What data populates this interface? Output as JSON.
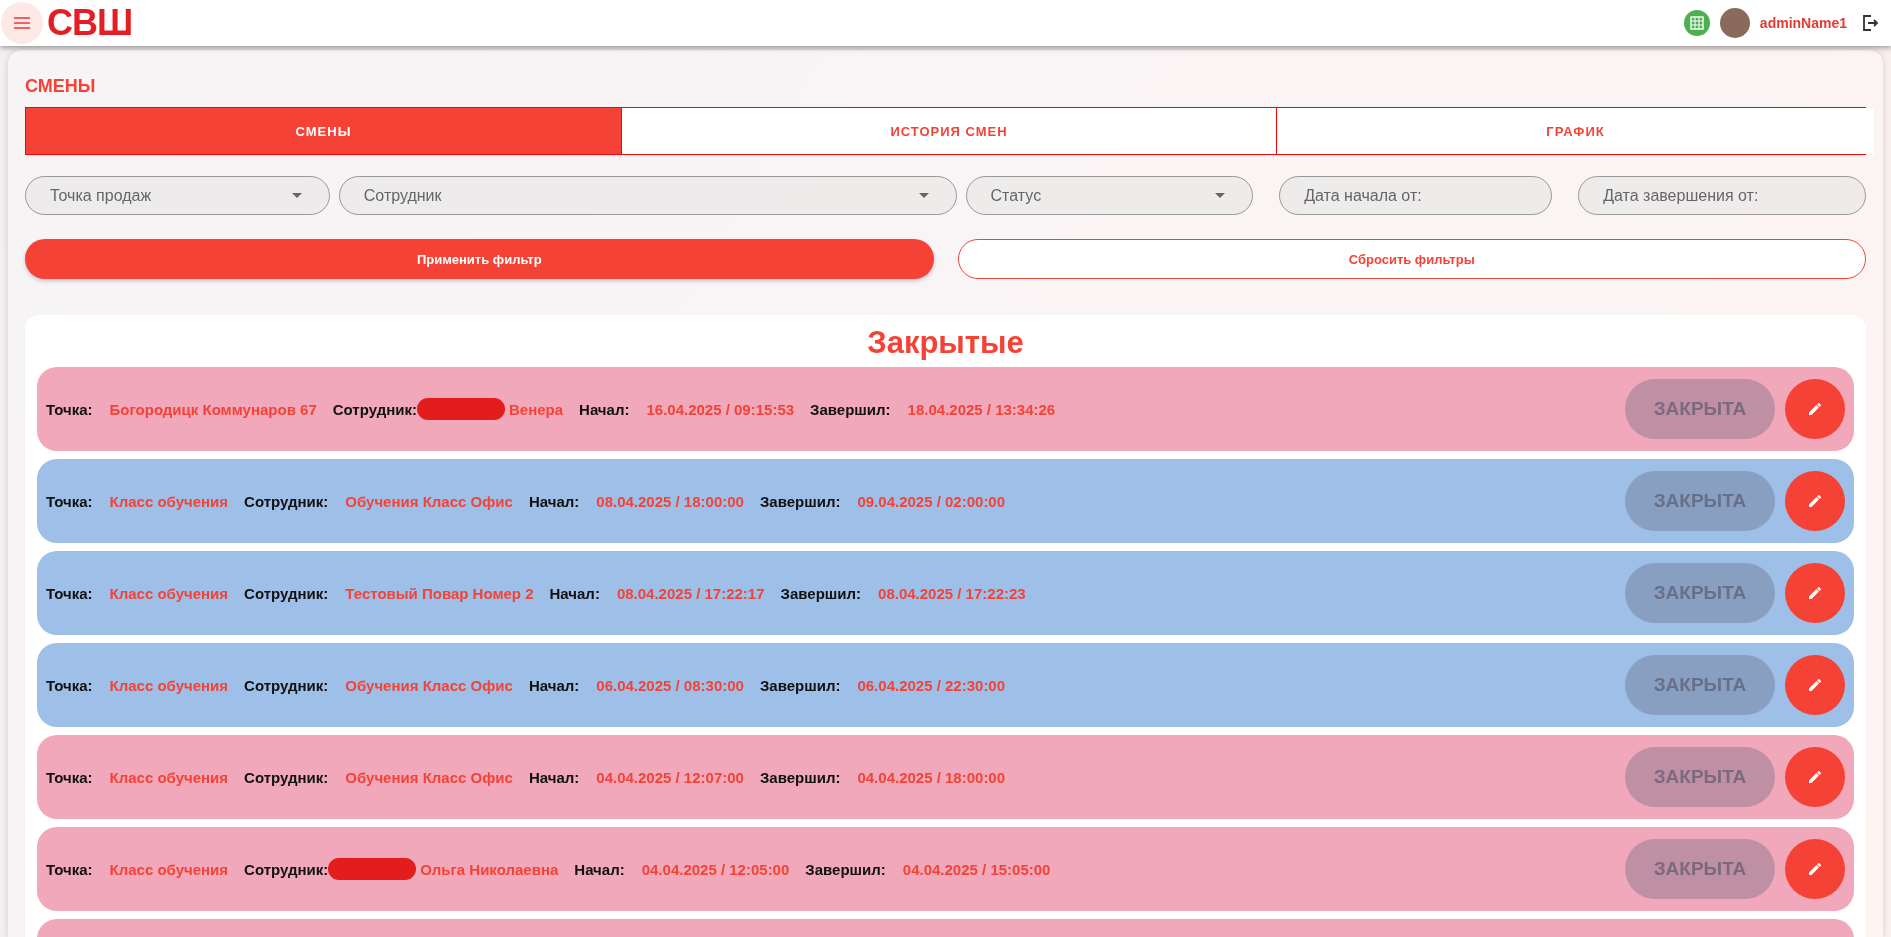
{
  "header": {
    "logo": "СВШ",
    "user_name": "adminName1"
  },
  "page": {
    "title": "СМЕНЫ",
    "tabs": [
      {
        "label": "СМЕНЫ",
        "selected": true
      },
      {
        "label": "ИСТОРИЯ СМЕН",
        "selected": false
      },
      {
        "label": "ГРАФИК",
        "selected": false
      }
    ],
    "filters": [
      {
        "kind": "select",
        "placeholder": "Точка продаж"
      },
      {
        "kind": "select",
        "placeholder": "Сотрудник"
      },
      {
        "kind": "select",
        "placeholder": "Статус"
      },
      {
        "kind": "date",
        "placeholder": "Дата начала от:"
      },
      {
        "kind": "date",
        "placeholder": "Дата завершения от:"
      }
    ],
    "apply_button": "Применить фильтр",
    "reset_button": "Сбросить фильтры"
  },
  "shifts": {
    "title": "Закрытые",
    "rows": [
      {
        "color": "#f0a8ba",
        "point_label": "Точка:",
        "point": "Богородицк Коммунаров 67",
        "employee_label": "Сотрудник:",
        "employee": "Венера",
        "employee_redacted": true,
        "start_label": "Начал:",
        "start": "16.04.2025 / 09:15:53",
        "end_label": "Завершил:",
        "end": "18.04.2025 / 13:34:26",
        "status": "ЗАКРЫТА"
      },
      {
        "color": "#9dbfe8",
        "point_label": "Точка:",
        "point": "Класс обучения",
        "employee_label": "Сотрудник:",
        "employee": "Обучения Класс Офис",
        "employee_redacted": false,
        "start_label": "Начал:",
        "start": "08.04.2025 / 18:00:00",
        "end_label": "Завершил:",
        "end": "09.04.2025 / 02:00:00",
        "status": "ЗАКРЫТА"
      },
      {
        "color": "#9dbfe8",
        "point_label": "Точка:",
        "point": "Класс обучения",
        "employee_label": "Сотрудник:",
        "employee": "Тестовый Повар Номер 2",
        "employee_redacted": false,
        "start_label": "Начал:",
        "start": "08.04.2025 / 17:22:17",
        "end_label": "Завершил:",
        "end": "08.04.2025 / 17:22:23",
        "status": "ЗАКРЫТА"
      },
      {
        "color": "#9dbfe8",
        "point_label": "Точка:",
        "point": "Класс обучения",
        "employee_label": "Сотрудник:",
        "employee": "Обучения Класс Офис",
        "employee_redacted": false,
        "start_label": "Начал:",
        "start": "06.04.2025 / 08:30:00",
        "end_label": "Завершил:",
        "end": "06.04.2025 / 22:30:00",
        "status": "ЗАКРЫТА"
      },
      {
        "color": "#f0a8ba",
        "point_label": "Точка:",
        "point": "Класс обучения",
        "employee_label": "Сотрудник:",
        "employee": "Обучения Класс Офис",
        "employee_redacted": false,
        "start_label": "Начал:",
        "start": "04.04.2025 / 12:07:00",
        "end_label": "Завершил:",
        "end": "04.04.2025 / 18:00:00",
        "status": "ЗАКРЫТА"
      },
      {
        "color": "#f0a8ba",
        "point_label": "Точка:",
        "point": "Класс обучения",
        "employee_label": "Сотрудник:",
        "employee": "Ольга Николаевна",
        "employee_redacted": true,
        "start_label": "Начал:",
        "start": "04.04.2025 / 12:05:00",
        "end_label": "Завершил:",
        "end": "04.04.2025 / 15:05:00",
        "status": "ЗАКРЫТА"
      }
    ],
    "cut_row": {
      "color": "#f0a8ba"
    }
  }
}
